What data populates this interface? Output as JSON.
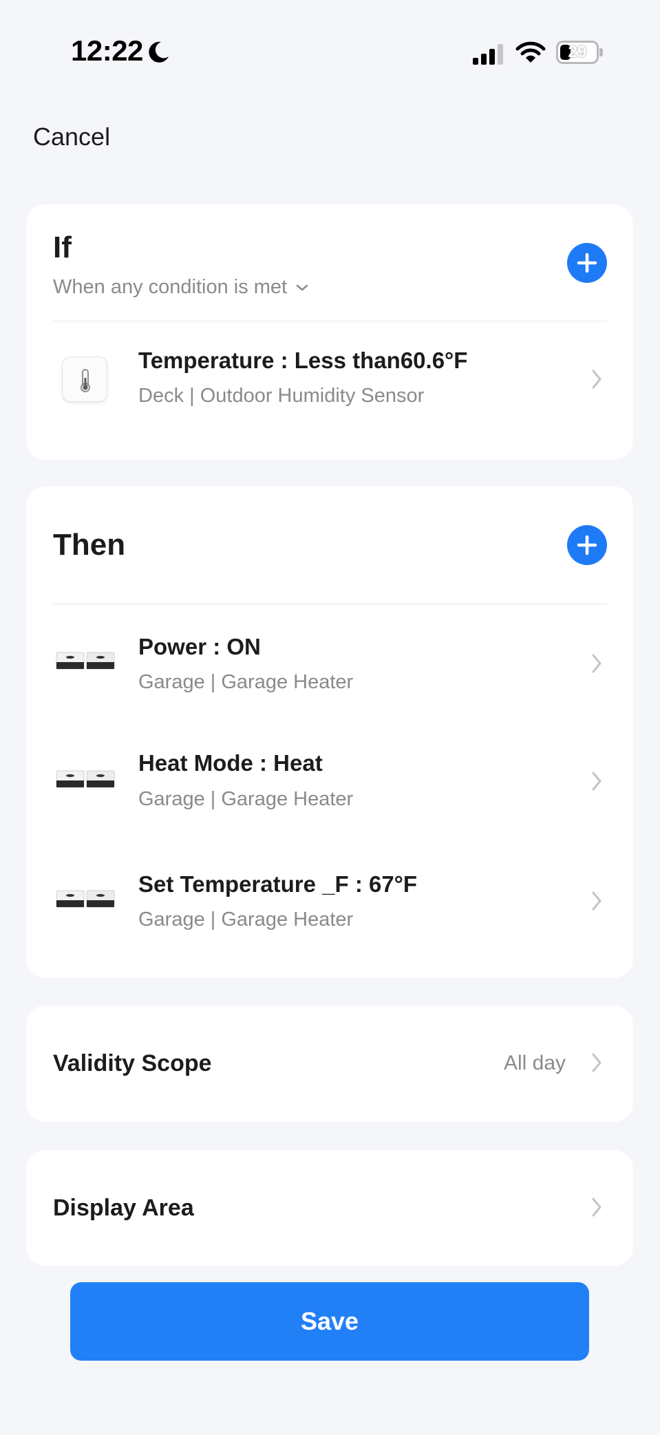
{
  "status_bar": {
    "time": "12:22",
    "battery": "29"
  },
  "header": {
    "cancel_label": "Cancel"
  },
  "if_section": {
    "title": "If",
    "condition_mode": "When any condition is met",
    "conditions": [
      {
        "title": "Temperature : Less than60.6°F",
        "subtitle": "Deck | Outdoor Humidity Sensor"
      }
    ]
  },
  "then_section": {
    "title": "Then",
    "actions": [
      {
        "title": "Power : ON",
        "subtitle": "Garage | Garage Heater"
      },
      {
        "title": "Heat Mode : Heat",
        "subtitle": "Garage | Garage Heater"
      },
      {
        "title": "Set Temperature _F : 67°F",
        "subtitle": "Garage | Garage Heater"
      }
    ]
  },
  "validity": {
    "label": "Validity Scope",
    "value": "All day"
  },
  "display_area": {
    "label": "Display Area"
  },
  "footer": {
    "save_label": "Save"
  },
  "colors": {
    "accent": "#1f7bf5",
    "save": "#2280f6",
    "background": "#f5f6fa"
  }
}
